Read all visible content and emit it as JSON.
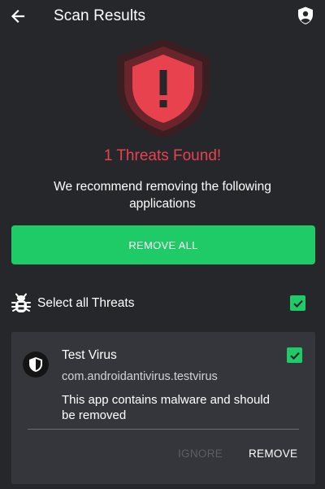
{
  "header": {
    "title": "Scan Results",
    "back_icon": "arrow-back-icon",
    "action_icon": "shield-user-icon"
  },
  "summary": {
    "heading": "1 Threats Found!",
    "recommendation": "We recommend removing the following applications",
    "status_icon": "shield-alert-icon"
  },
  "actions": {
    "remove_all_label": "REMOVE ALL"
  },
  "select_all": {
    "label": "Select all Threats",
    "checked": true,
    "icon": "bug-icon"
  },
  "threats": [
    {
      "name": "Test Virus",
      "package": "com.androidantivirus.testvirus",
      "description": "This app contains malware and should be removed",
      "checked": true,
      "ignore_label": "IGNORE",
      "remove_label": "REMOVE",
      "icon": "app-shield-icon"
    }
  ],
  "colors": {
    "background": "#26272b",
    "card": "#35363b",
    "accent_green": "#1ecb66",
    "threat_red": "#e8424f",
    "muted": "#5d5e63"
  }
}
